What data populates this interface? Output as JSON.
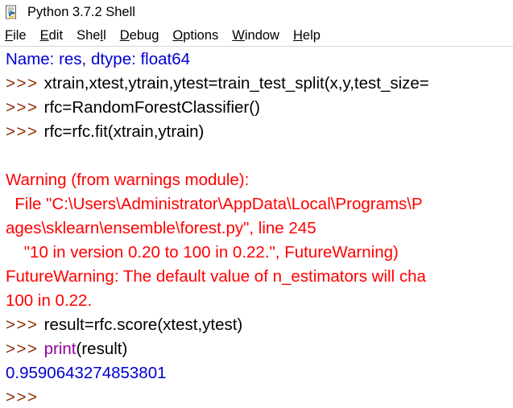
{
  "window": {
    "title": "Python 3.7.2 Shell",
    "icon": "python-idle-icon"
  },
  "menubar": {
    "items": [
      {
        "name": "file",
        "pre": "",
        "mnemonic": "F",
        "post": "ile"
      },
      {
        "name": "edit",
        "pre": "",
        "mnemonic": "E",
        "post": "dit"
      },
      {
        "name": "shell",
        "pre": "She",
        "mnemonic": "l",
        "post": "l"
      },
      {
        "name": "debug",
        "pre": "",
        "mnemonic": "D",
        "post": "ebug"
      },
      {
        "name": "options",
        "pre": "",
        "mnemonic": "O",
        "post": "ptions"
      },
      {
        "name": "window",
        "pre": "",
        "mnemonic": "W",
        "post": "indow"
      },
      {
        "name": "help",
        "pre": "",
        "mnemonic": "H",
        "post": "elp"
      }
    ]
  },
  "colors": {
    "prompt": "#8b2d00",
    "output": "#0000d0",
    "error": "#ff0000",
    "builtin": "#9000a0",
    "code": "#000000",
    "background": "#ffffff"
  },
  "shell": {
    "lines": [
      {
        "name": "output-dtype",
        "spans": [
          {
            "text": "Name: res, dtype: float64",
            "style": "c-output"
          }
        ]
      },
      {
        "name": "input-train-test-split",
        "spans": [
          {
            "text": ">>> ",
            "style": "c-prompt"
          },
          {
            "text": "xtrain,xtest,ytrain,ytest=train_test_split(x,y,test_size=",
            "style": "c-code"
          }
        ]
      },
      {
        "name": "input-randomforestclassifier",
        "spans": [
          {
            "text": ">>> ",
            "style": "c-prompt"
          },
          {
            "text": "rfc=RandomForestClassifier()",
            "style": "c-code"
          }
        ]
      },
      {
        "name": "input-rfc-fit",
        "spans": [
          {
            "text": ">>> ",
            "style": "c-prompt"
          },
          {
            "text": "rfc=rfc.fit(xtrain,ytrain)",
            "style": "c-code"
          }
        ]
      },
      {
        "name": "blank-line",
        "spans": [
          {
            "text": " ",
            "style": "c-code"
          }
        ]
      },
      {
        "name": "warning-header",
        "spans": [
          {
            "text": "Warning (from warnings module):",
            "style": "c-error"
          }
        ]
      },
      {
        "name": "warning-file-path",
        "spans": [
          {
            "text": "  File \"C:\\Users\\Administrator\\AppData\\Local\\Programs\\P",
            "style": "c-error"
          }
        ]
      },
      {
        "name": "warning-file-path-wrap",
        "spans": [
          {
            "text": "ages\\sklearn\\ensemble\\forest.py\", line 245",
            "style": "c-error"
          }
        ]
      },
      {
        "name": "warning-source-line",
        "spans": [
          {
            "text": "    \"10 in version 0.20 to 100 in 0.22.\", FutureWarning)",
            "style": "c-error"
          }
        ]
      },
      {
        "name": "warning-message",
        "spans": [
          {
            "text": "FutureWarning: The default value of n_estimators will cha",
            "style": "c-error"
          }
        ]
      },
      {
        "name": "warning-message-wrap",
        "spans": [
          {
            "text": "100 in 0.22.",
            "style": "c-error"
          }
        ]
      },
      {
        "name": "input-rfc-score",
        "spans": [
          {
            "text": ">>> ",
            "style": "c-prompt"
          },
          {
            "text": "result=rfc.score(xtest,ytest)",
            "style": "c-code"
          }
        ]
      },
      {
        "name": "input-print-result",
        "spans": [
          {
            "text": ">>> ",
            "style": "c-prompt"
          },
          {
            "text": "print",
            "style": "c-builtin"
          },
          {
            "text": "(result)",
            "style": "c-code"
          }
        ]
      },
      {
        "name": "output-score-value",
        "spans": [
          {
            "text": "0.9590643274853801",
            "style": "c-output"
          }
        ]
      },
      {
        "name": "prompt-current",
        "spans": [
          {
            "text": ">>> ",
            "style": "c-prompt"
          }
        ]
      }
    ]
  }
}
